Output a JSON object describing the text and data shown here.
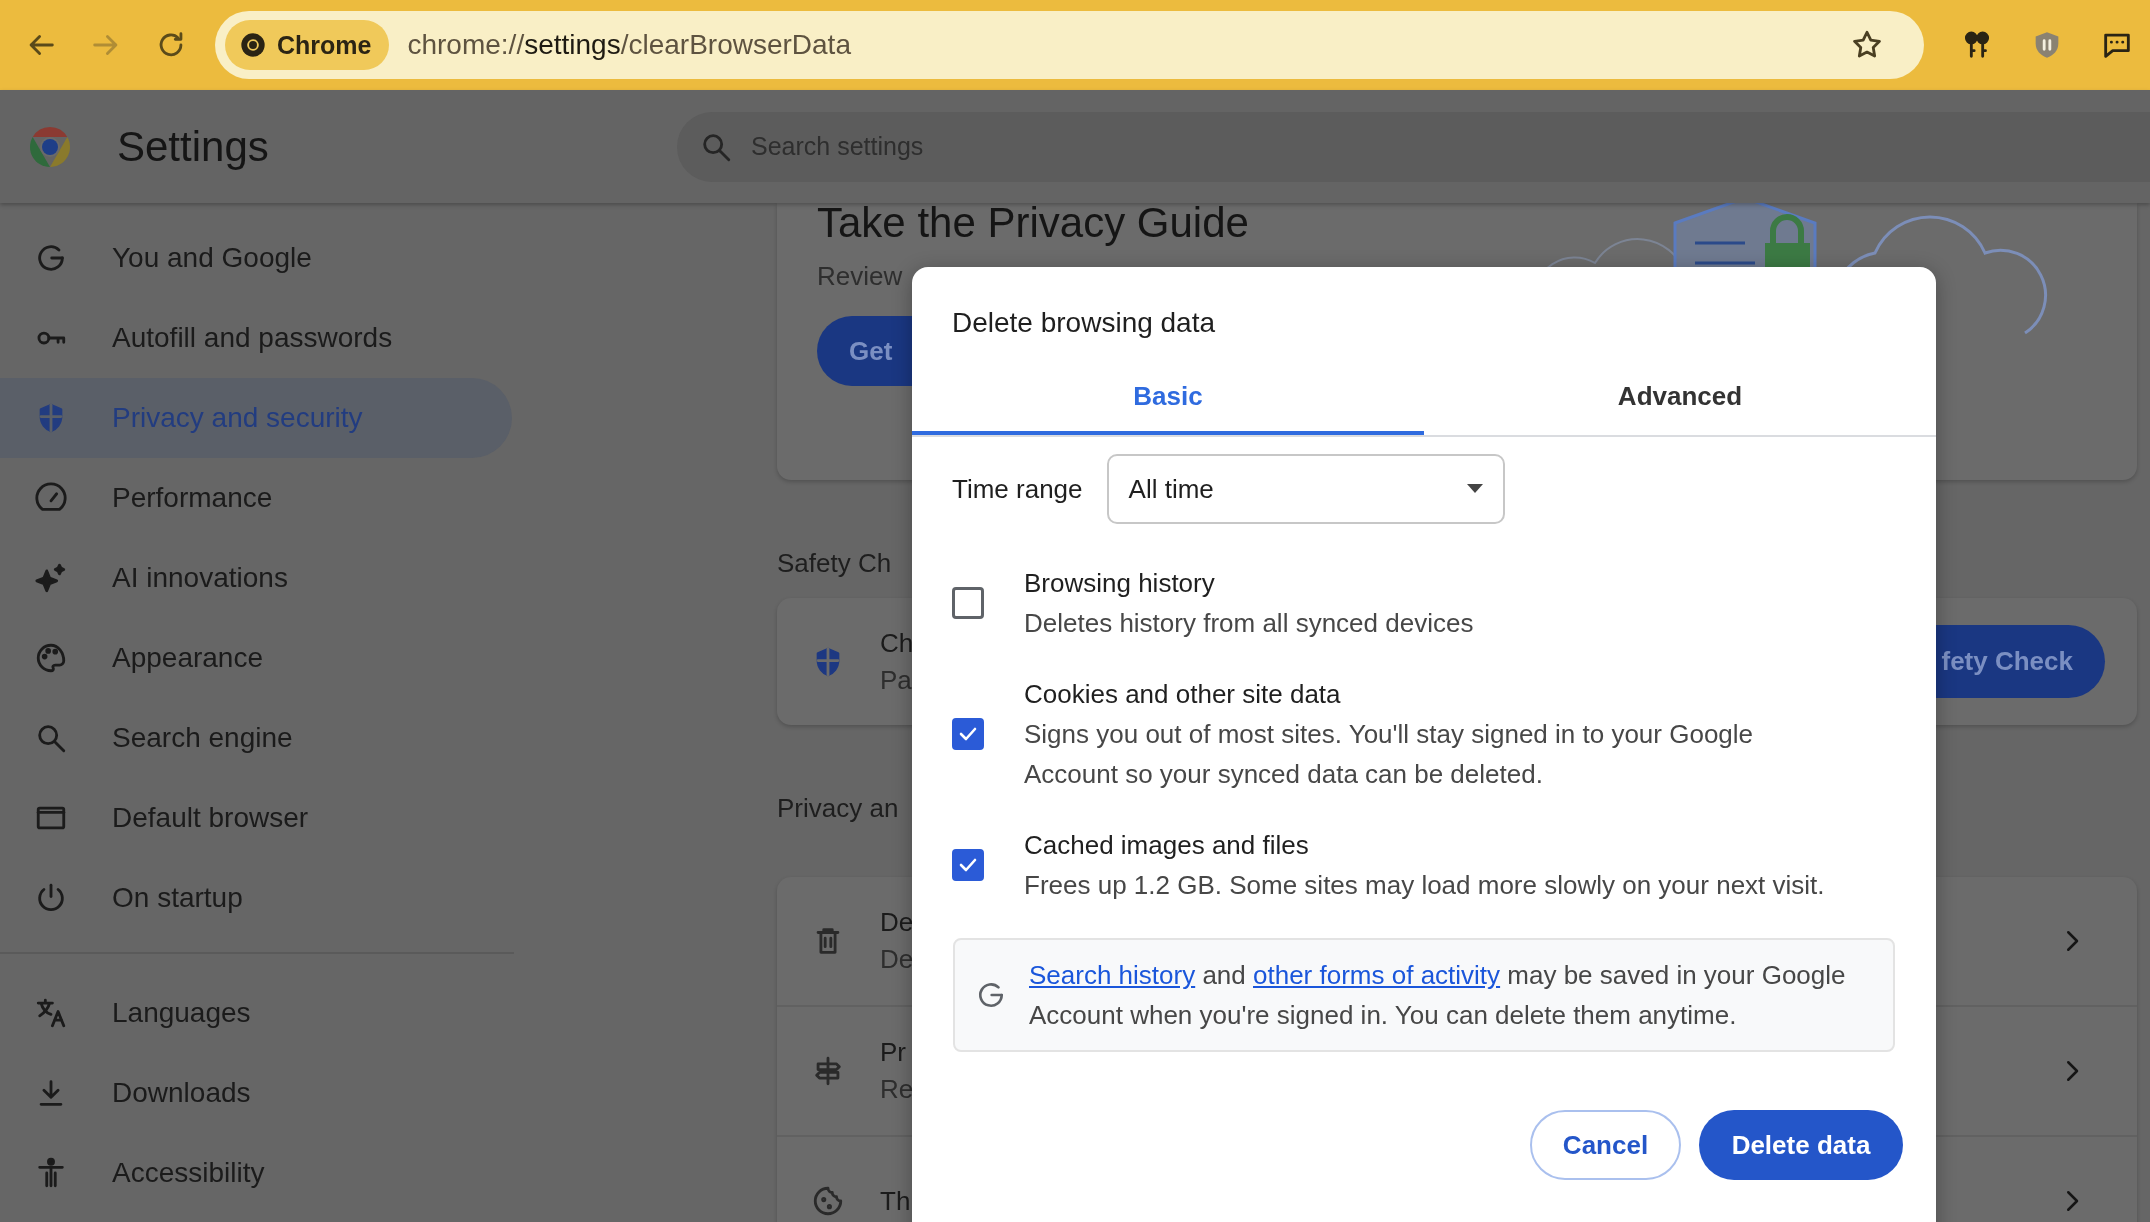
{
  "address_bar": {
    "chip": "Chrome",
    "url": "chrome://**settings**/clearBrowserData"
  },
  "header": {
    "title": "Settings",
    "search": {
      "placeholder": "Search settings"
    }
  },
  "sidebar": {
    "sections": [
      {
        "items": [
          {
            "label": "You and Google",
            "selected": false
          },
          {
            "label": "Autofill and passwords",
            "selected": false
          },
          {
            "label": "Privacy and security",
            "selected": true
          },
          {
            "label": "Performance",
            "selected": false
          },
          {
            "label": "AI innovations",
            "selected": false
          },
          {
            "label": "Appearance",
            "selected": false
          },
          {
            "label": "Search engine",
            "selected": false
          },
          {
            "label": "Default browser",
            "selected": false
          },
          {
            "label": "On startup",
            "selected": false
          }
        ]
      },
      {
        "items": [
          {
            "label": "Languages",
            "selected": false
          },
          {
            "label": "Downloads",
            "selected": false
          },
          {
            "label": "Accessibility",
            "selected": false
          }
        ]
      }
    ]
  },
  "main": {
    "privacy_guide": {
      "title": "Take the Privacy Guide",
      "text": "Review",
      "button": "Get"
    },
    "safety_check": {
      "heading": "Safety Ch",
      "title": "Ch",
      "subtitle": "Pa",
      "button": "fety Check"
    },
    "privacy": {
      "heading": "Privacy an",
      "rows": [
        {
          "title": "De",
          "subtitle": "De"
        },
        {
          "title": "Pr",
          "subtitle": "Re"
        },
        {
          "title": "Th"
        }
      ]
    }
  },
  "dialog": {
    "title": "Delete browsing data",
    "tabs": [
      {
        "label": "Basic",
        "selected": true
      },
      {
        "label": "Advanced",
        "selected": false
      }
    ],
    "time_range": {
      "label": "Time range",
      "value": "All time"
    },
    "options": [
      {
        "title": "Browsing history",
        "description": "Deletes history from all synced devices",
        "checked": false
      },
      {
        "title": "Cookies and other site data",
        "description": "Signs you out of most sites. You'll stay signed in to your Google Account so your synced data can be deleted.",
        "checked": true
      },
      {
        "title": "Cached images and files",
        "description": "Frees up 1.2 GB. Some sites may load more slowly on your next visit.",
        "checked": true
      }
    ],
    "info": {
      "parts": [
        {
          "text": "Search history",
          "link": true
        },
        {
          "text": " and ",
          "link": false
        },
        {
          "text": "other forms of activity",
          "link": true
        },
        {
          "text": " may be saved in your Google Account when you're signed in. You can delete them anytime.",
          "link": false
        }
      ]
    },
    "buttons": [
      {
        "label": "Cancel",
        "kind": "secondary"
      },
      {
        "label": "Delete data",
        "kind": "primary"
      }
    ]
  }
}
